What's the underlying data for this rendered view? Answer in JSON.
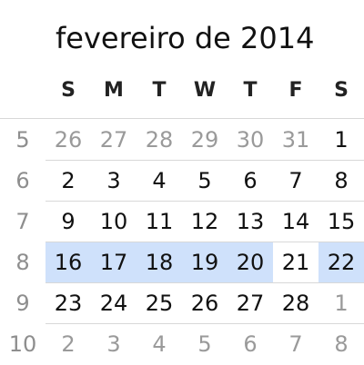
{
  "calendar": {
    "month_title": "fevereiro de 2014",
    "weekdays": [
      "S",
      "M",
      "T",
      "W",
      "T",
      "F",
      "S"
    ],
    "selection_color": "#cfe1fb",
    "weeks": [
      {
        "num": "5",
        "days": [
          {
            "d": "26",
            "m": "other"
          },
          {
            "d": "27",
            "m": "other"
          },
          {
            "d": "28",
            "m": "other"
          },
          {
            "d": "29",
            "m": "other"
          },
          {
            "d": "30",
            "m": "other"
          },
          {
            "d": "31",
            "m": "other"
          },
          {
            "d": "1",
            "m": "cur"
          }
        ]
      },
      {
        "num": "6",
        "days": [
          {
            "d": "2",
            "m": "cur"
          },
          {
            "d": "3",
            "m": "cur"
          },
          {
            "d": "4",
            "m": "cur"
          },
          {
            "d": "5",
            "m": "cur"
          },
          {
            "d": "6",
            "m": "cur"
          },
          {
            "d": "7",
            "m": "cur"
          },
          {
            "d": "8",
            "m": "cur"
          }
        ]
      },
      {
        "num": "7",
        "days": [
          {
            "d": "9",
            "m": "cur"
          },
          {
            "d": "10",
            "m": "cur"
          },
          {
            "d": "11",
            "m": "cur"
          },
          {
            "d": "12",
            "m": "cur"
          },
          {
            "d": "13",
            "m": "cur"
          },
          {
            "d": "14",
            "m": "cur"
          },
          {
            "d": "15",
            "m": "cur"
          }
        ]
      },
      {
        "num": "8",
        "days": [
          {
            "d": "16",
            "m": "cur",
            "sel": true
          },
          {
            "d": "17",
            "m": "cur",
            "sel": true
          },
          {
            "d": "18",
            "m": "cur",
            "sel": true
          },
          {
            "d": "19",
            "m": "cur",
            "sel": true
          },
          {
            "d": "20",
            "m": "cur",
            "sel": true
          },
          {
            "d": "21",
            "m": "cur"
          },
          {
            "d": "22",
            "m": "cur",
            "sel": true
          }
        ]
      },
      {
        "num": "9",
        "days": [
          {
            "d": "23",
            "m": "cur"
          },
          {
            "d": "24",
            "m": "cur"
          },
          {
            "d": "25",
            "m": "cur"
          },
          {
            "d": "26",
            "m": "cur"
          },
          {
            "d": "27",
            "m": "cur"
          },
          {
            "d": "28",
            "m": "cur"
          },
          {
            "d": "1",
            "m": "other"
          }
        ]
      },
      {
        "num": "10",
        "days": [
          {
            "d": "2",
            "m": "other"
          },
          {
            "d": "3",
            "m": "other"
          },
          {
            "d": "4",
            "m": "other"
          },
          {
            "d": "5",
            "m": "other"
          },
          {
            "d": "6",
            "m": "other"
          },
          {
            "d": "7",
            "m": "other"
          },
          {
            "d": "8",
            "m": "other"
          }
        ]
      }
    ]
  }
}
